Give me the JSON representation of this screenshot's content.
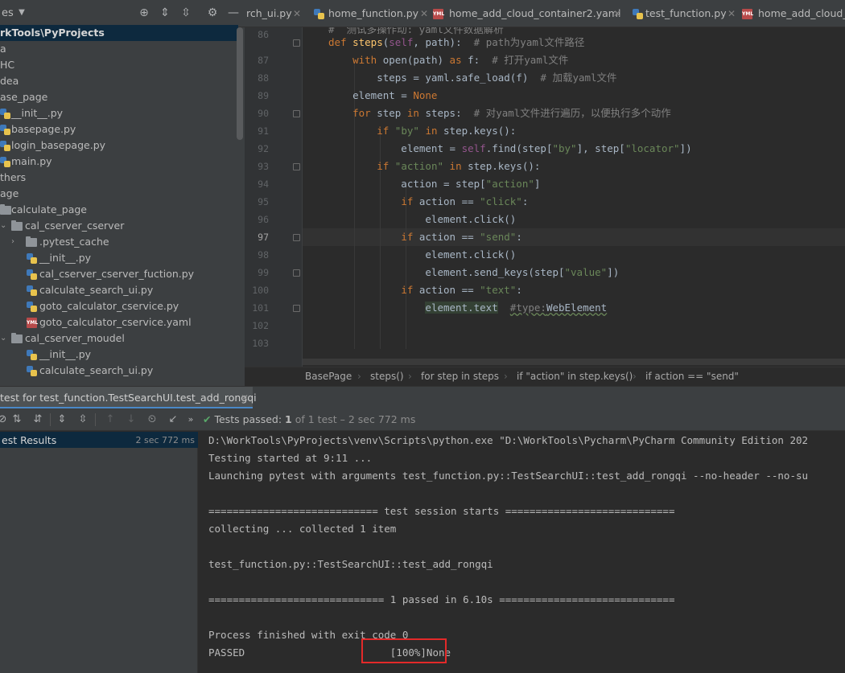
{
  "project": {
    "title": "es",
    "items": [
      {
        "label": "rkTools\\PyProjects",
        "selected": true
      },
      {
        "label": "a"
      },
      {
        "label": "HC"
      },
      {
        "label": "dea"
      },
      {
        "label": "ase_page"
      },
      {
        "label": "__init__.py"
      },
      {
        "label": "basepage.py"
      },
      {
        "label": "login_basepage.py"
      },
      {
        "label": "main.py"
      },
      {
        "label": "thers"
      },
      {
        "label": "age"
      },
      {
        "label": "calculate_page"
      },
      {
        "label": "cal_cserver_cserver"
      },
      {
        "label": ".pytest_cache"
      },
      {
        "label": "__init__.py"
      },
      {
        "label": "cal_cserver_cserver_fuction.py"
      },
      {
        "label": "calculate_search_ui.py"
      },
      {
        "label": "goto_calculator_cservice.py"
      },
      {
        "label": "goto_calculator_cservice.yaml"
      },
      {
        "label": "cal_cserver_moudel"
      },
      {
        "label": "__init__.py"
      },
      {
        "label": "calculate_search_ui.py"
      }
    ]
  },
  "tabs": [
    {
      "label": "rch_ui.py",
      "icon": "python-file-icon"
    },
    {
      "label": "home_function.py",
      "icon": "python-file-icon"
    },
    {
      "label": "home_add_cloud_container2.yaml",
      "icon": "yaml-file-icon"
    },
    {
      "label": "test_function.py",
      "icon": "python-file-icon"
    },
    {
      "label": "home_add_cloud_c",
      "icon": "yaml-file-icon"
    }
  ],
  "editor": {
    "line_numbers": [
      "86",
      "87",
      "88",
      "89",
      "90",
      "91",
      "92",
      "93",
      "94",
      "95",
      "96",
      "97",
      "98",
      "99",
      "100",
      "101",
      "102",
      "103"
    ],
    "active_line": "97"
  },
  "breadcrumb": [
    "BasePage",
    "steps()",
    "for step in steps",
    "if \"action\" in step.keys()",
    "if action == \"send\""
  ],
  "run": {
    "tab_label": "test for test_function.TestSearchUI.test_add_rongqi",
    "tests_passed": "Tests passed:",
    "passed_count": "1",
    "passed_detail": "of 1 test – 2 sec 772 ms",
    "tree_root": "est Results",
    "tree_root_time": "2 sec 772 ms",
    "console_lines": [
      "D:\\WorkTools\\PyProjects\\venv\\Scripts\\python.exe \"D:\\WorkTools\\Pycharm\\PyCharm Community Edition 202",
      "Testing started at 9:11 ...",
      "Launching pytest with arguments test_function.py::TestSearchUI::test_add_rongqi --no-header --no-su",
      "",
      "============================ test session starts ============================",
      "collecting ... collected 1 item",
      "",
      "test_function.py::TestSearchUI::test_add_rongqi",
      "",
      "============================= 1 passed in 6.10s =============================",
      "",
      "Process finished with exit code 0",
      "PASSED                        [100%]None"
    ]
  },
  "colors": {
    "highlight_box": "#e32929",
    "pass_green": "#59a869"
  }
}
